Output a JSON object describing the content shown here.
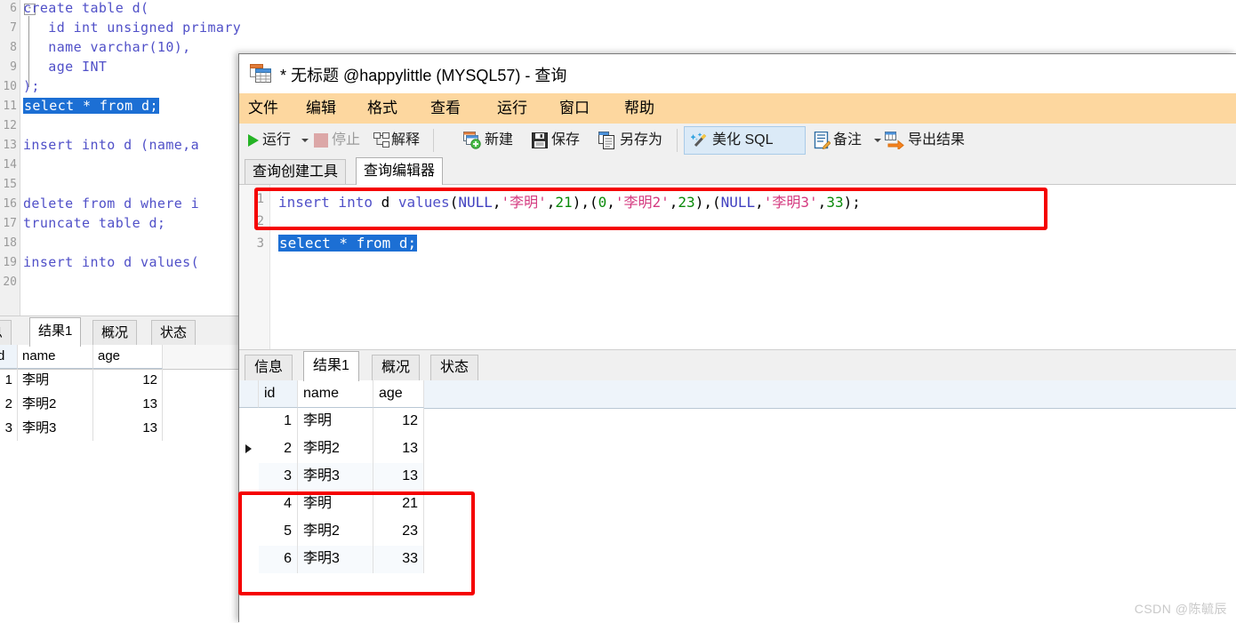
{
  "background_window": {
    "editor": {
      "line_numbers": [
        "6",
        "7",
        "8",
        "9",
        "10",
        "11",
        "12",
        "13",
        "14",
        "15",
        "16",
        "17",
        "18",
        "19",
        "20"
      ],
      "lines": [
        "create table d(",
        "   id int unsigned primary key auto_increment,",
        "   name varchar(10),",
        "   age INT",
        ");",
        "select * from d;",
        "",
        "insert into d (name,a",
        "",
        "",
        "delete from d where i",
        "truncate table d;",
        "",
        "insert into d values(",
        ""
      ],
      "selected_line": "select * from d;"
    },
    "result_tabs": [
      {
        "label": "息",
        "active": false
      },
      {
        "label": "结果1",
        "active": true
      },
      {
        "label": "概况",
        "active": false
      },
      {
        "label": "状态",
        "active": false
      }
    ],
    "grid": {
      "columns": [
        "d",
        "name",
        "age"
      ],
      "rows": [
        {
          "id": "1",
          "name": "李明",
          "age": "12"
        },
        {
          "id": "2",
          "name": "李明2",
          "age": "13"
        },
        {
          "id": "3",
          "name": "李明3",
          "age": "13"
        }
      ]
    }
  },
  "dialog": {
    "title": "* 无标题 @happylittle (MYSQL57) - 查询",
    "title_icon": "query-table-icon",
    "menu": [
      {
        "label": "文件"
      },
      {
        "label": "编辑"
      },
      {
        "label": "格式"
      },
      {
        "label": "查看"
      },
      {
        "label": "运行"
      },
      {
        "label": "窗口"
      },
      {
        "label": "帮助"
      }
    ],
    "toolbar": {
      "run": "运行",
      "stop": "停止",
      "explain": "解释",
      "new": "新建",
      "save": "保存",
      "save_as": "另存为",
      "beautify_sql": "美化 SQL",
      "remark": "备注",
      "export_result": "导出结果"
    },
    "editor_tabs": [
      {
        "label": "查询创建工具",
        "active": false
      },
      {
        "label": "查询编辑器",
        "active": true
      }
    ],
    "editor": {
      "line_numbers": [
        "1",
        "2",
        "3"
      ],
      "statement": {
        "kw_insert": "insert into",
        "table": "d",
        "kw_values": "values",
        "full": "insert into d values(NULL,'李明',21),(0,'李明2',23),(NULL,'李明3',33);",
        "tuples": [
          {
            "id": "NULL",
            "name": "'李明'",
            "age": "21"
          },
          {
            "id": "0",
            "name": "'李明2'",
            "age": "23"
          },
          {
            "id": "NULL",
            "name": "'李明3'",
            "age": "33"
          }
        ]
      },
      "selected_line": "select * from d;"
    },
    "result_tabs": [
      {
        "label": "信息",
        "active": false
      },
      {
        "label": "结果1",
        "active": true
      },
      {
        "label": "概况",
        "active": false
      },
      {
        "label": "状态",
        "active": false
      }
    ],
    "grid": {
      "columns": [
        "id",
        "name",
        "age"
      ],
      "rows": [
        {
          "id": "1",
          "name": "李明",
          "age": "12",
          "selected": false
        },
        {
          "id": "2",
          "name": "李明2",
          "age": "13",
          "selected": true
        },
        {
          "id": "3",
          "name": "李明3",
          "age": "13",
          "selected": false
        },
        {
          "id": "4",
          "name": "李明",
          "age": "21",
          "selected": false
        },
        {
          "id": "5",
          "name": "李明2",
          "age": "23",
          "selected": false
        },
        {
          "id": "6",
          "name": "李明3",
          "age": "33",
          "selected": false
        }
      ]
    }
  },
  "annotations": {
    "highlight_color": "#f50000",
    "box_sql": "insert statement highlighted",
    "box_rows": "new rows 4-6 highlighted"
  },
  "watermark": "CSDN @陈毓辰",
  "colors": {
    "menubar": "#fdd79f",
    "accent_selection": "#1c6fd4",
    "keyword": "#5050c8",
    "string": "#d4397f",
    "number": "#0a8a0a",
    "annotation": "#f50000"
  }
}
